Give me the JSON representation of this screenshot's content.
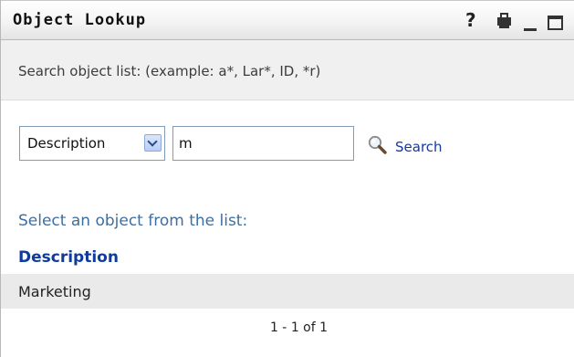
{
  "window": {
    "title": "Object Lookup",
    "help_icon": "?",
    "controls": [
      "help-icon",
      "print-icon",
      "minimize-icon",
      "maximize-icon"
    ]
  },
  "search": {
    "hint": "Search object list: (example: a*, Lar*, ID, *r)",
    "attribute_selected": "Description",
    "query_value": "m",
    "button_label": "Search",
    "button_icon": "magnifier-icon"
  },
  "results": {
    "heading": "Select an object from the list:",
    "column_header": "Description",
    "rows": [
      {
        "description": "Marketing"
      }
    ],
    "pager": "1 - 1 of 1"
  },
  "colors": {
    "link": "#15399c",
    "header": "#0e3b9c",
    "heading": "#3f6f9e",
    "row_bg": "#eaeaea"
  }
}
